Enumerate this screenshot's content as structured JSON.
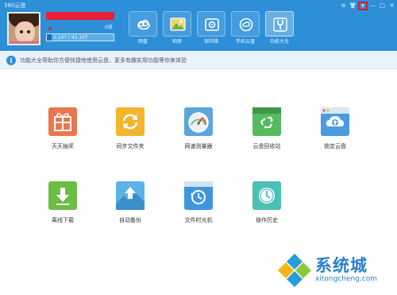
{
  "window": {
    "title": "360云盘",
    "controls": [
      "≡",
      "👕",
      "▾",
      "—",
      "□",
      "✕"
    ]
  },
  "user": {
    "vip_text": "6级",
    "storage_text": "3.10T / 43.10T",
    "storage_used_fraction": 0.07
  },
  "nav": {
    "items": [
      {
        "label": "网盘",
        "icon": "cloud-disk-icon",
        "active": false
      },
      {
        "label": "相册",
        "icon": "photo-album-icon",
        "active": false
      },
      {
        "label": "保险箱",
        "icon": "safe-box-icon",
        "active": false
      },
      {
        "label": "手机云盘",
        "icon": "phone-cloud-icon",
        "active": false
      },
      {
        "label": "功能大全",
        "icon": "tools-icon",
        "active": true
      }
    ]
  },
  "info": {
    "text": "功能大全帮助你方便快捷地使用云盘，更多有趣实用功能等你来体验"
  },
  "features": [
    {
      "label": "天天抽奖",
      "icon": "gift-icon",
      "color": "#e8774e"
    },
    {
      "label": "同步文件夹",
      "icon": "sync-folder-icon",
      "color": "#f2b52c"
    },
    {
      "label": "网速测量器",
      "icon": "speedometer-icon",
      "color": "#5aa7dd"
    },
    {
      "label": "云盘回收站",
      "icon": "recycle-bin-icon",
      "color": "#57b960"
    },
    {
      "label": "锁定云盘",
      "icon": "lock-cloud-icon",
      "color": "#4b9be0"
    },
    {
      "label": "离线下载",
      "icon": "download-icon",
      "color": "#6dbd45"
    },
    {
      "label": "自动备份",
      "icon": "auto-backup-icon",
      "color": "#5fb2e5"
    },
    {
      "label": "文件时光机",
      "icon": "time-machine-icon",
      "color": "#3f96dc"
    },
    {
      "label": "操作历史",
      "icon": "history-icon",
      "color": "#4cc0b4"
    }
  ],
  "watermark": {
    "name": "系统城",
    "url": "xitongcheng.com"
  }
}
